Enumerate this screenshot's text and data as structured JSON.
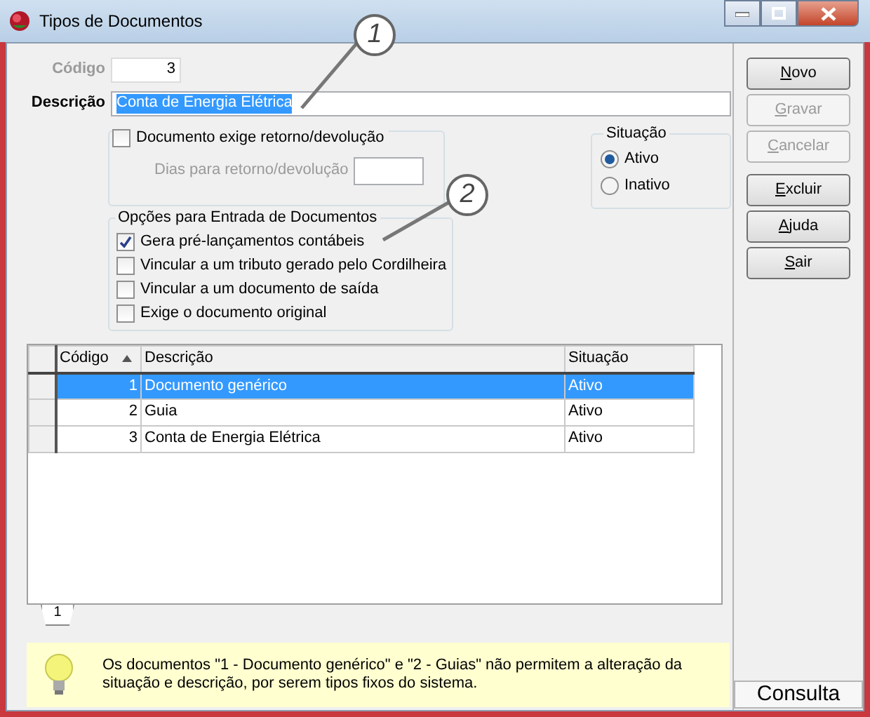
{
  "window": {
    "title": "Tipos de Documentos"
  },
  "form": {
    "code_label": "Código",
    "code_value": "3",
    "code_disabled": true,
    "description_label": "Descrição",
    "description_value": "Conta de Energia Elétrica",
    "description_selected": true
  },
  "return_group": {
    "label": "Documento exige retorno/devolução",
    "checked": false,
    "days_label": "Dias para retorno/devolução",
    "days_disabled": true
  },
  "status_group": {
    "title": "Situação",
    "options": [
      {
        "label": "Ativo",
        "selected": true
      },
      {
        "label": "Inativo",
        "selected": false
      }
    ]
  },
  "options_group": {
    "title": "Opções para Entrada de Documentos",
    "items": [
      {
        "label": "Gera pré-lançamentos contábeis",
        "checked": true
      },
      {
        "label": "Vincular a um tributo gerado pelo Cordilheira",
        "checked": false
      },
      {
        "label": "Vincular a um documento de saída",
        "checked": false
      },
      {
        "label": "Exige o documento original",
        "checked": false
      }
    ]
  },
  "table": {
    "columns": [
      {
        "label": "Código",
        "sorted": true
      },
      {
        "label": "Descrição",
        "sorted": false
      },
      {
        "label": "Situação",
        "sorted": false
      }
    ],
    "rows": [
      {
        "cells": [
          "1",
          "Documento genérico",
          "Ativo"
        ],
        "selected": true
      },
      {
        "cells": [
          "2",
          "Guia",
          "Ativo"
        ],
        "selected": false
      },
      {
        "cells": [
          "3",
          "Conta de Energia Elétrica",
          "Ativo"
        ],
        "selected": false
      }
    ]
  },
  "page_tabs": [
    {
      "label": "1",
      "selected": true
    }
  ],
  "hint": "Os documentos \"1 - Documento genérico\" e \"2 - Guias\" não permitem a alteração da situação e descrição, por serem tipos fixos do sistema.",
  "buttons": [
    {
      "label": "Novo",
      "disabled": false
    },
    {
      "label": "Gravar",
      "disabled": true
    },
    {
      "label": "Cancelar",
      "disabled": true
    },
    {
      "label": "Excluir",
      "disabled": false
    },
    {
      "label": "Ajuda",
      "disabled": false
    },
    {
      "label": "Sair",
      "disabled": false
    }
  ],
  "status_bar": "Consulta",
  "callouts": [
    "1",
    "2"
  ]
}
